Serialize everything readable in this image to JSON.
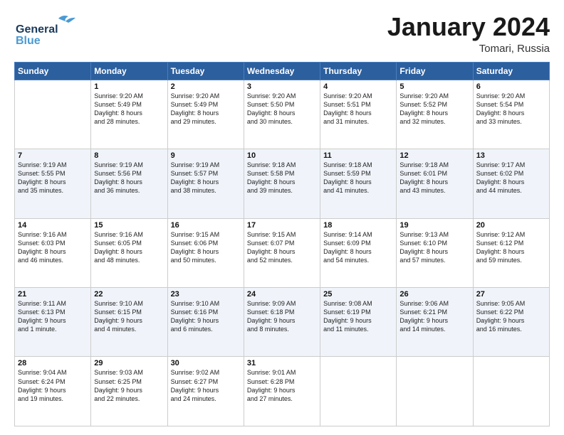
{
  "logo": {
    "line1": "General",
    "line2": "Blue"
  },
  "title": "January 2024",
  "location": "Tomari, Russia",
  "days_header": [
    "Sunday",
    "Monday",
    "Tuesday",
    "Wednesday",
    "Thursday",
    "Friday",
    "Saturday"
  ],
  "weeks": [
    {
      "shaded": false,
      "cells": [
        {
          "day": "",
          "info": ""
        },
        {
          "day": "1",
          "info": "Sunrise: 9:20 AM\nSunset: 5:49 PM\nDaylight: 8 hours\nand 28 minutes."
        },
        {
          "day": "2",
          "info": "Sunrise: 9:20 AM\nSunset: 5:49 PM\nDaylight: 8 hours\nand 29 minutes."
        },
        {
          "day": "3",
          "info": "Sunrise: 9:20 AM\nSunset: 5:50 PM\nDaylight: 8 hours\nand 30 minutes."
        },
        {
          "day": "4",
          "info": "Sunrise: 9:20 AM\nSunset: 5:51 PM\nDaylight: 8 hours\nand 31 minutes."
        },
        {
          "day": "5",
          "info": "Sunrise: 9:20 AM\nSunset: 5:52 PM\nDaylight: 8 hours\nand 32 minutes."
        },
        {
          "day": "6",
          "info": "Sunrise: 9:20 AM\nSunset: 5:54 PM\nDaylight: 8 hours\nand 33 minutes."
        }
      ]
    },
    {
      "shaded": true,
      "cells": [
        {
          "day": "7",
          "info": "Sunrise: 9:19 AM\nSunset: 5:55 PM\nDaylight: 8 hours\nand 35 minutes."
        },
        {
          "day": "8",
          "info": "Sunrise: 9:19 AM\nSunset: 5:56 PM\nDaylight: 8 hours\nand 36 minutes."
        },
        {
          "day": "9",
          "info": "Sunrise: 9:19 AM\nSunset: 5:57 PM\nDaylight: 8 hours\nand 38 minutes."
        },
        {
          "day": "10",
          "info": "Sunrise: 9:18 AM\nSunset: 5:58 PM\nDaylight: 8 hours\nand 39 minutes."
        },
        {
          "day": "11",
          "info": "Sunrise: 9:18 AM\nSunset: 5:59 PM\nDaylight: 8 hours\nand 41 minutes."
        },
        {
          "day": "12",
          "info": "Sunrise: 9:18 AM\nSunset: 6:01 PM\nDaylight: 8 hours\nand 43 minutes."
        },
        {
          "day": "13",
          "info": "Sunrise: 9:17 AM\nSunset: 6:02 PM\nDaylight: 8 hours\nand 44 minutes."
        }
      ]
    },
    {
      "shaded": false,
      "cells": [
        {
          "day": "14",
          "info": "Sunrise: 9:16 AM\nSunset: 6:03 PM\nDaylight: 8 hours\nand 46 minutes."
        },
        {
          "day": "15",
          "info": "Sunrise: 9:16 AM\nSunset: 6:05 PM\nDaylight: 8 hours\nand 48 minutes."
        },
        {
          "day": "16",
          "info": "Sunrise: 9:15 AM\nSunset: 6:06 PM\nDaylight: 8 hours\nand 50 minutes."
        },
        {
          "day": "17",
          "info": "Sunrise: 9:15 AM\nSunset: 6:07 PM\nDaylight: 8 hours\nand 52 minutes."
        },
        {
          "day": "18",
          "info": "Sunrise: 9:14 AM\nSunset: 6:09 PM\nDaylight: 8 hours\nand 54 minutes."
        },
        {
          "day": "19",
          "info": "Sunrise: 9:13 AM\nSunset: 6:10 PM\nDaylight: 8 hours\nand 57 minutes."
        },
        {
          "day": "20",
          "info": "Sunrise: 9:12 AM\nSunset: 6:12 PM\nDaylight: 8 hours\nand 59 minutes."
        }
      ]
    },
    {
      "shaded": true,
      "cells": [
        {
          "day": "21",
          "info": "Sunrise: 9:11 AM\nSunset: 6:13 PM\nDaylight: 9 hours\nand 1 minute."
        },
        {
          "day": "22",
          "info": "Sunrise: 9:10 AM\nSunset: 6:15 PM\nDaylight: 9 hours\nand 4 minutes."
        },
        {
          "day": "23",
          "info": "Sunrise: 9:10 AM\nSunset: 6:16 PM\nDaylight: 9 hours\nand 6 minutes."
        },
        {
          "day": "24",
          "info": "Sunrise: 9:09 AM\nSunset: 6:18 PM\nDaylight: 9 hours\nand 8 minutes."
        },
        {
          "day": "25",
          "info": "Sunrise: 9:08 AM\nSunset: 6:19 PM\nDaylight: 9 hours\nand 11 minutes."
        },
        {
          "day": "26",
          "info": "Sunrise: 9:06 AM\nSunset: 6:21 PM\nDaylight: 9 hours\nand 14 minutes."
        },
        {
          "day": "27",
          "info": "Sunrise: 9:05 AM\nSunset: 6:22 PM\nDaylight: 9 hours\nand 16 minutes."
        }
      ]
    },
    {
      "shaded": false,
      "cells": [
        {
          "day": "28",
          "info": "Sunrise: 9:04 AM\nSunset: 6:24 PM\nDaylight: 9 hours\nand 19 minutes."
        },
        {
          "day": "29",
          "info": "Sunrise: 9:03 AM\nSunset: 6:25 PM\nDaylight: 9 hours\nand 22 minutes."
        },
        {
          "day": "30",
          "info": "Sunrise: 9:02 AM\nSunset: 6:27 PM\nDaylight: 9 hours\nand 24 minutes."
        },
        {
          "day": "31",
          "info": "Sunrise: 9:01 AM\nSunset: 6:28 PM\nDaylight: 9 hours\nand 27 minutes."
        },
        {
          "day": "",
          "info": ""
        },
        {
          "day": "",
          "info": ""
        },
        {
          "day": "",
          "info": ""
        }
      ]
    }
  ]
}
